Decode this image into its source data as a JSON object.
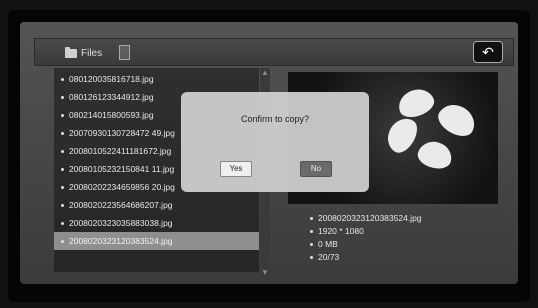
{
  "header": {
    "files_label": "Files"
  },
  "file_list": [
    "080120035816718.jpg",
    "080126123344912.jpg",
    "080214015800593.jpg",
    "20070930130728472 49.jpg",
    "2008010522411181672.jpg",
    "20080105232150841 11.jpg",
    "20080202234659856 20.jpg",
    "2008020223564686207.jpg",
    "2008020323035883038.jpg",
    "2008020323120383524.jpg"
  ],
  "selected_index": 9,
  "info": {
    "name": "2008020323120383524.jpg",
    "resolution": "1920 * 1080",
    "size": "0 MB",
    "position": "20/73"
  },
  "dialog": {
    "message": "Confirm to copy?",
    "yes_label": "Yes",
    "no_label": "No"
  },
  "icons": {
    "back": "back-arrow-icon",
    "files": "folder-icon",
    "doc": "document-icon"
  }
}
